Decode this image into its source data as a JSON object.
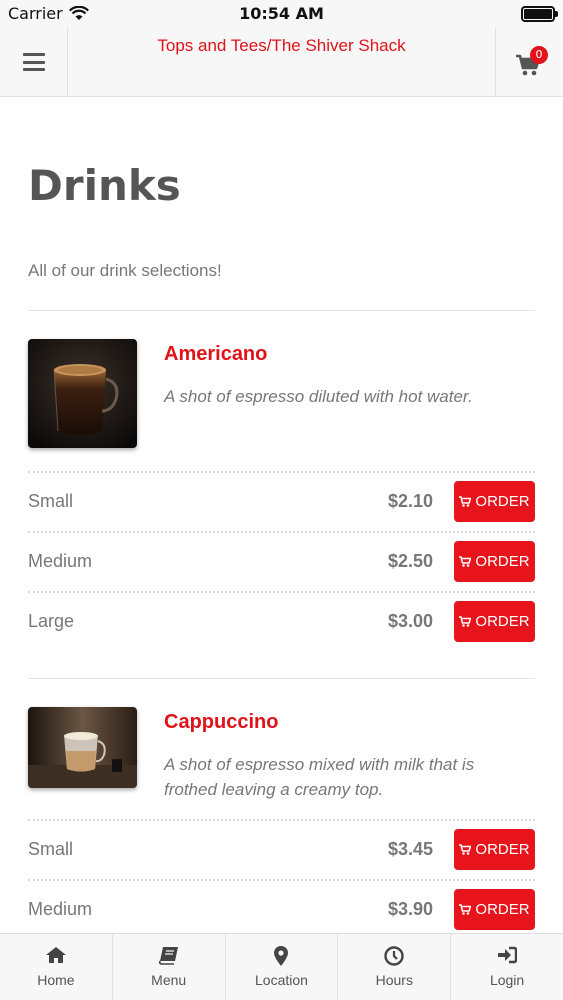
{
  "status_bar": {
    "carrier": "Carrier",
    "time": "10:54 AM"
  },
  "header": {
    "title": "Tops and Tees/The Shiver Shack",
    "cart_count": "0"
  },
  "page": {
    "title": "Drinks",
    "subtitle": "All of our drink selections!"
  },
  "items": [
    {
      "name": "Americano",
      "description": "A shot of espresso diluted with hot water.",
      "sizes": [
        {
          "label": "Small",
          "price": "$2.10",
          "button": "ORDER"
        },
        {
          "label": "Medium",
          "price": "$2.50",
          "button": "ORDER"
        },
        {
          "label": "Large",
          "price": "$3.00",
          "button": "ORDER"
        }
      ]
    },
    {
      "name": "Cappuccino",
      "description": "A shot of espresso mixed with milk that is frothed leaving a creamy top.",
      "sizes": [
        {
          "label": "Small",
          "price": "$3.45",
          "button": "ORDER"
        },
        {
          "label": "Medium",
          "price": "$3.90",
          "button": "ORDER"
        }
      ]
    }
  ],
  "tabs": [
    {
      "label": "Home",
      "icon": "home-icon"
    },
    {
      "label": "Menu",
      "icon": "book-icon"
    },
    {
      "label": "Location",
      "icon": "map-pin-icon"
    },
    {
      "label": "Hours",
      "icon": "clock-icon"
    },
    {
      "label": "Login",
      "icon": "sign-in-icon"
    }
  ],
  "colors": {
    "accent": "#e0121a",
    "button": "#e8141c",
    "text": "#555555",
    "bar": "#f7f7f7"
  }
}
